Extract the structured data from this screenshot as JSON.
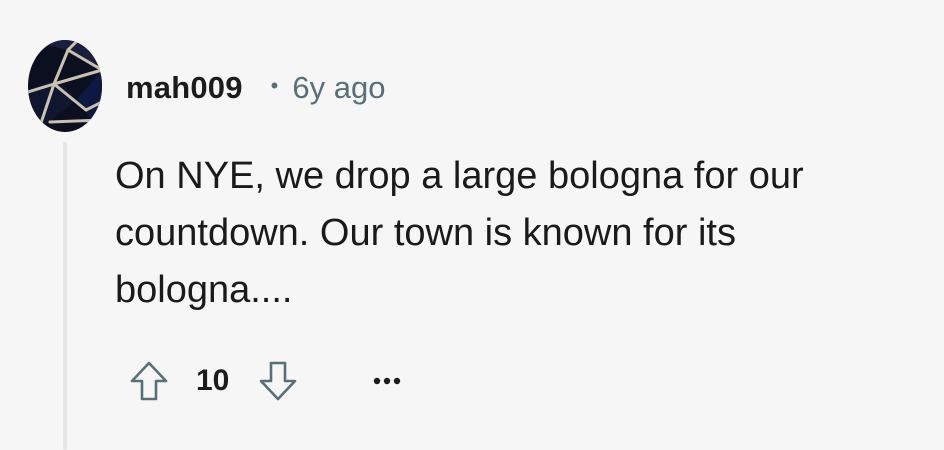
{
  "comment": {
    "author": "mah009",
    "separator": "•",
    "timestamp": "6y ago",
    "body": "On NYE, we drop a large bologna for our countdown. Our town is known for its bologna....",
    "score": "10",
    "avatar_icon": "geometric-avatar-icon",
    "upvote_icon": "upvote-arrow-icon",
    "downvote_icon": "downvote-arrow-icon",
    "more_icon": "more-options-icon"
  },
  "colors": {
    "background": "#f6f6f7",
    "username": "#1c1c1c",
    "meta": "#576f76",
    "body_text": "#1a1a1b",
    "thread_line": "#e3e5e8",
    "icon": "#576f76"
  }
}
